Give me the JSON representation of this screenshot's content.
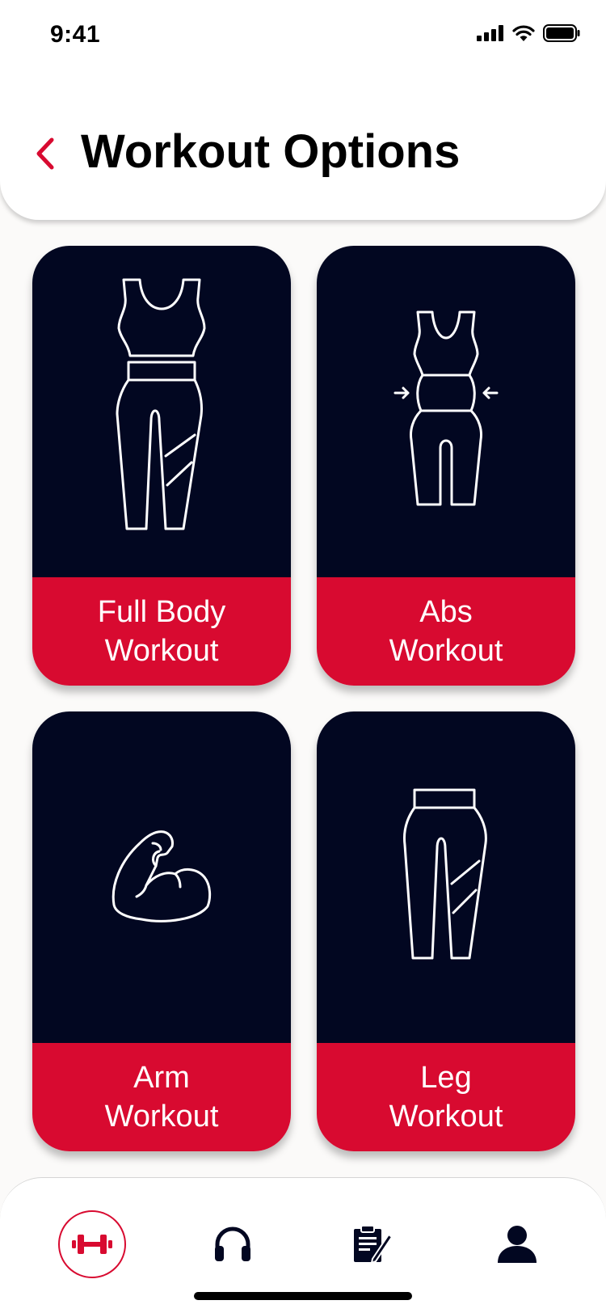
{
  "status_bar": {
    "time": "9:41"
  },
  "header": {
    "title": "Workout Options"
  },
  "cards": [
    {
      "line1": "Full Body",
      "line2": "Workout",
      "icon": "full-body-outfit-icon"
    },
    {
      "line1": "Abs",
      "line2": "Workout",
      "icon": "abs-waist-icon"
    },
    {
      "line1": "Arm",
      "line2": "Workout",
      "icon": "flexed-bicep-icon"
    },
    {
      "line1": "Leg",
      "line2": "Workout",
      "icon": "leggings-icon"
    }
  ],
  "bottom_nav": {
    "items": [
      "dumbbell-icon",
      "headphones-icon",
      "clipboard-icon",
      "profile-icon"
    ],
    "active_index": 0
  },
  "colors": {
    "card_dark": "#020721",
    "accent_red": "#D80A30",
    "background": "#FBFAF9"
  }
}
